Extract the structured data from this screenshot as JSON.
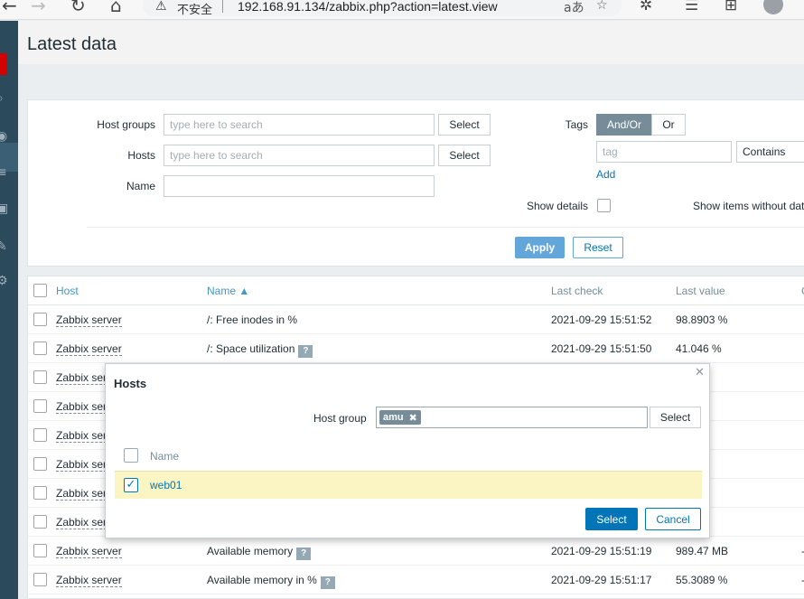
{
  "browser": {
    "insecure_label": "不安全",
    "url": "192.168.91.134/zabbix.php?action=latest.view"
  },
  "page": {
    "title": "Latest data"
  },
  "filter": {
    "host_groups_label": "Host groups",
    "hosts_label": "Hosts",
    "name_label": "Name",
    "search_placeholder": "type here to search",
    "select_label": "Select",
    "name_value": "",
    "tags_label": "Tags",
    "tags_and_or": "And/Or",
    "tags_or": "Or",
    "tag_placeholder": "tag",
    "tag_operator": "Contains",
    "add_label": "Add",
    "show_details_label": "Show details",
    "show_items_without_data_label": "Show items without dat",
    "apply_label": "Apply",
    "reset_label": "Reset"
  },
  "table": {
    "headers": {
      "host": "Host",
      "name": "Name ▲",
      "last_check": "Last check",
      "last_value": "Last value",
      "extra": "C"
    },
    "rows": [
      {
        "host": "Zabbix server",
        "name": "/: Free inodes in %",
        "help": false,
        "last_check": "2021-09-29 15:51:52",
        "last_value": "98.8903 %",
        "extra": ""
      },
      {
        "host": "Zabbix server",
        "name": "/: Space utilization",
        "help": true,
        "last_check": "2021-09-29 15:51:50",
        "last_value": "41.046 %",
        "extra": ""
      },
      {
        "host": "Zabbix ser",
        "name": "",
        "help": false,
        "last_check": "",
        "last_value": "GB",
        "extra": ""
      },
      {
        "host": "Zabbix ser",
        "name": "",
        "help": false,
        "last_check": "",
        "last_value": "B",
        "extra": ""
      },
      {
        "host": "Zabbix ser",
        "name": "",
        "help": false,
        "last_check": "",
        "last_value": "4 %",
        "extra": ""
      },
      {
        "host": "Zabbix ser",
        "name": "",
        "help": false,
        "last_check": "",
        "last_value": "%",
        "extra": ""
      },
      {
        "host": "Zabbix ser",
        "name": "",
        "help": false,
        "last_check": "",
        "last_value": "B",
        "extra": ""
      },
      {
        "host": "Zabbix ser",
        "name": "",
        "help": false,
        "last_check": "",
        "last_value": "MB",
        "extra": ""
      },
      {
        "host": "Zabbix server",
        "name": "Available memory",
        "help": true,
        "last_check": "2021-09-29 15:51:19",
        "last_value": "989.47 MB",
        "extra": "-"
      },
      {
        "host": "Zabbix server",
        "name": "Available memory in %",
        "help": true,
        "last_check": "2021-09-29 15:51:17",
        "last_value": "55.3089 %",
        "extra": "-"
      }
    ]
  },
  "dialog": {
    "title": "Hosts",
    "host_group_label": "Host group",
    "host_group_chip": "amu",
    "select_label": "Select",
    "name_header": "Name",
    "rows": [
      {
        "name": "web01",
        "checked": true
      }
    ],
    "submit_label": "Select",
    "cancel_label": "Cancel"
  }
}
